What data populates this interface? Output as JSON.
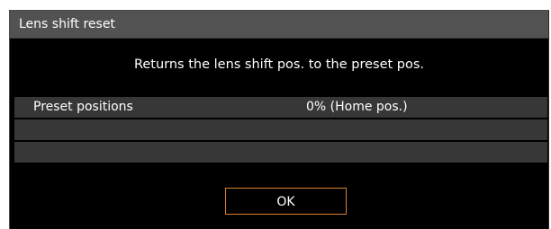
{
  "dialog": {
    "title": "Lens shift reset",
    "message": "Returns the lens shift pos. to the preset pos.",
    "rows": [
      {
        "label": "Preset positions",
        "value": "0% (Home pos.)"
      },
      {
        "label": "",
        "value": ""
      },
      {
        "label": "",
        "value": ""
      }
    ],
    "ok_label": "OK"
  },
  "colors": {
    "background": "#000000",
    "title_bar": "#525252",
    "row": "#373737",
    "focus_border": "#d9822b",
    "text": "#ffffff"
  }
}
